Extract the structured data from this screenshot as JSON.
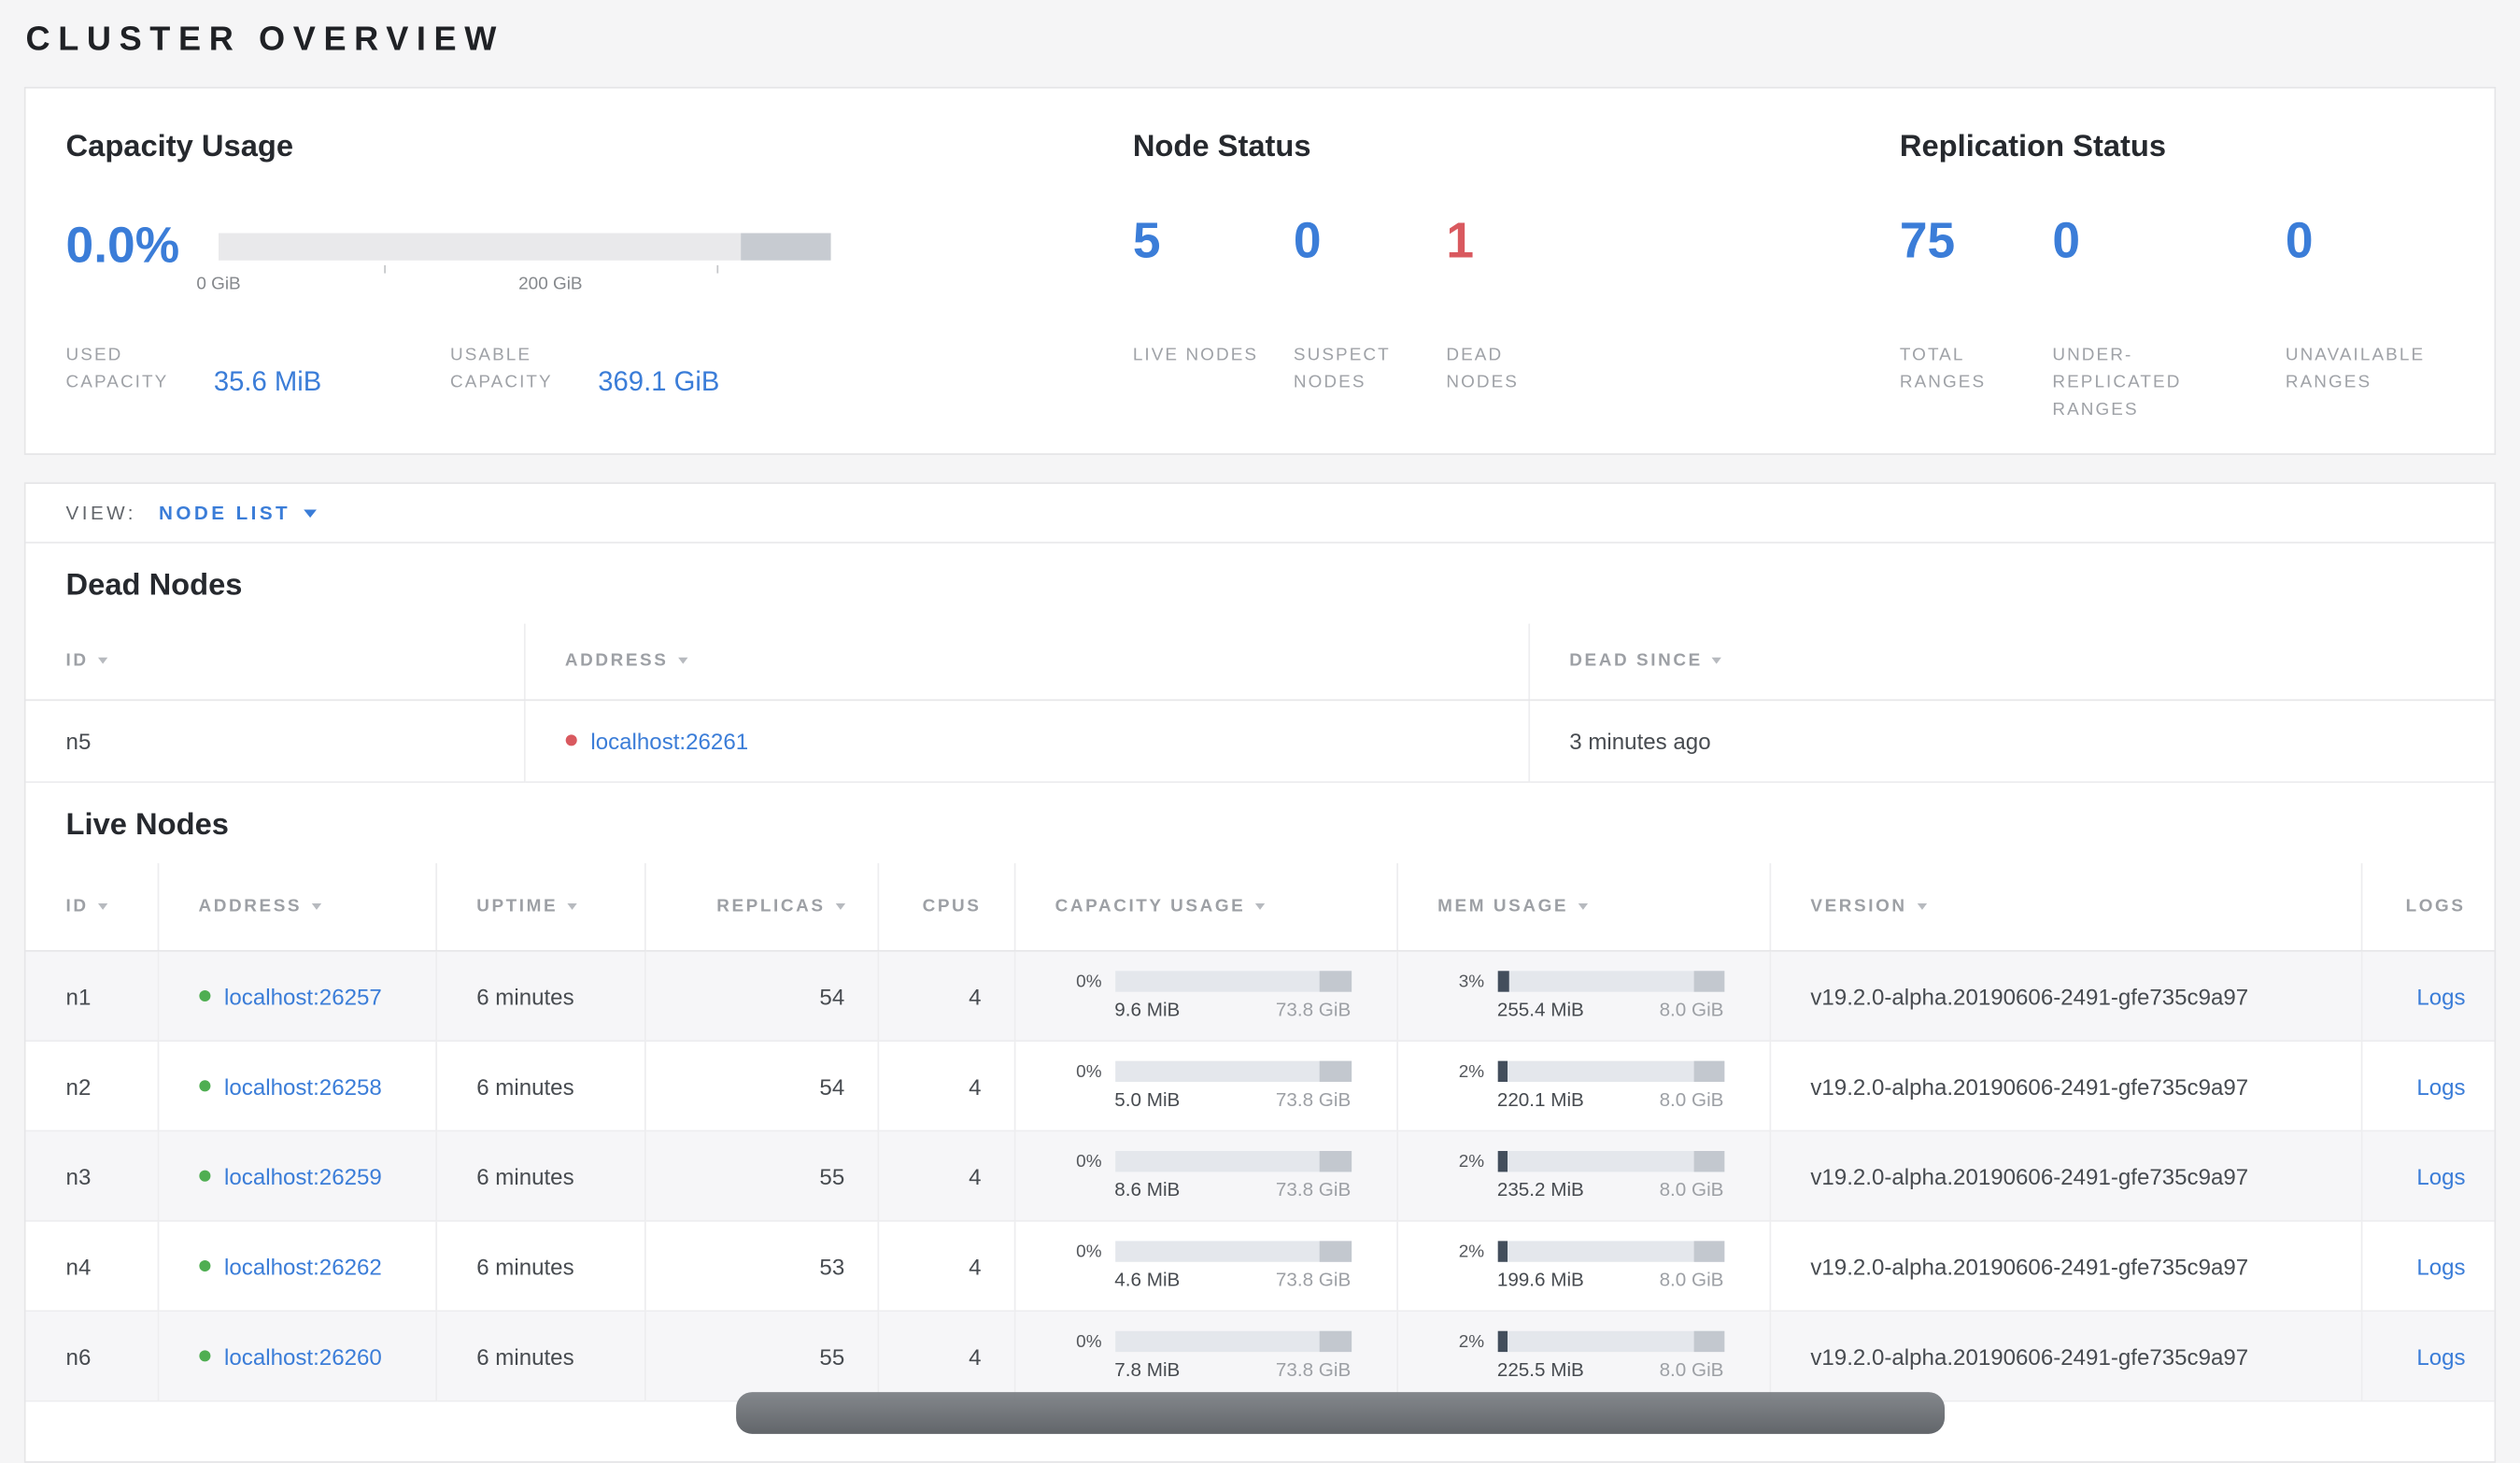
{
  "page": {
    "title": "CLUSTER OVERVIEW"
  },
  "colors": {
    "accent_blue": "#3b7dd8",
    "danger_red": "#d9595f",
    "healthy_green": "#4fae52"
  },
  "summary": {
    "capacity": {
      "title": "Capacity Usage",
      "percent": "0.0%",
      "bar": {
        "dark_from": 0.853
      },
      "axis": {
        "ticks": [
          {
            "pos": 0.0,
            "label": "0 GiB"
          },
          {
            "pos": 0.271,
            "label": ""
          },
          {
            "pos": 0.542,
            "label": "200 GiB"
          },
          {
            "pos": 0.813,
            "label": ""
          }
        ]
      },
      "used_label": "USED CAPACITY",
      "used_value": "35.6 MiB",
      "usable_label": "USABLE CAPACITY",
      "usable_value": "369.1 GiB"
    },
    "node_status": {
      "title": "Node Status",
      "stats": [
        {
          "value": "5",
          "label": "LIVE NODES",
          "color": "blue"
        },
        {
          "value": "0",
          "label": "SUSPECT NODES",
          "color": "blue"
        },
        {
          "value": "1",
          "label": "DEAD NODES",
          "color": "red"
        }
      ]
    },
    "replication": {
      "title": "Replication Status",
      "stats": [
        {
          "value": "75",
          "label": "TOTAL RANGES",
          "color": "blue"
        },
        {
          "value": "0",
          "label": "UNDER-REPLICATED RANGES",
          "color": "blue"
        },
        {
          "value": "0",
          "label": "UNAVAILABLE RANGES",
          "color": "blue"
        }
      ]
    }
  },
  "view_bar": {
    "label": "VIEW:",
    "selected": "NODE LIST"
  },
  "dead_nodes": {
    "title": "Dead Nodes",
    "headers": [
      {
        "label": "ID",
        "sortable": true
      },
      {
        "label": "ADDRESS",
        "sortable": true
      },
      {
        "label": "DEAD SINCE",
        "sortable": true
      }
    ],
    "rows": [
      {
        "id": "n5",
        "address": "localhost:26261",
        "dead_since": "3 minutes ago"
      }
    ]
  },
  "live_nodes": {
    "title": "Live Nodes",
    "bar_tail": 0.13,
    "headers": [
      {
        "label": "ID",
        "sortable": true
      },
      {
        "label": "ADDRESS",
        "sortable": true
      },
      {
        "label": "UPTIME",
        "sortable": true
      },
      {
        "label": "REPLICAS",
        "sortable": true
      },
      {
        "label": "CPUS",
        "sortable": false
      },
      {
        "label": "CAPACITY USAGE",
        "sortable": true
      },
      {
        "label": "MEM USAGE",
        "sortable": true
      },
      {
        "label": "VERSION",
        "sortable": true
      },
      {
        "label": "LOGS",
        "sortable": false
      }
    ],
    "rows": [
      {
        "id": "n1",
        "address": "localhost:26257",
        "uptime": "6 minutes",
        "replicas": "54",
        "cpus": "4",
        "capacity": {
          "pct": "0%",
          "used": "9.6 MiB",
          "total": "73.8 GiB"
        },
        "memory": {
          "pct": "3%",
          "used": "255.4 MiB",
          "total": "8.0 GiB"
        },
        "version": "v19.2.0-alpha.20190606-2491-gfe735c9a97",
        "logs": "Logs"
      },
      {
        "id": "n2",
        "address": "localhost:26258",
        "uptime": "6 minutes",
        "replicas": "54",
        "cpus": "4",
        "capacity": {
          "pct": "0%",
          "used": "5.0 MiB",
          "total": "73.8 GiB"
        },
        "memory": {
          "pct": "2%",
          "used": "220.1 MiB",
          "total": "8.0 GiB"
        },
        "version": "v19.2.0-alpha.20190606-2491-gfe735c9a97",
        "logs": "Logs"
      },
      {
        "id": "n3",
        "address": "localhost:26259",
        "uptime": "6 minutes",
        "replicas": "55",
        "cpus": "4",
        "capacity": {
          "pct": "0%",
          "used": "8.6 MiB",
          "total": "73.8 GiB"
        },
        "memory": {
          "pct": "2%",
          "used": "235.2 MiB",
          "total": "8.0 GiB"
        },
        "version": "v19.2.0-alpha.20190606-2491-gfe735c9a97",
        "logs": "Logs"
      },
      {
        "id": "n4",
        "address": "localhost:26262",
        "uptime": "6 minutes",
        "replicas": "53",
        "cpus": "4",
        "capacity": {
          "pct": "0%",
          "used": "4.6 MiB",
          "total": "73.8 GiB"
        },
        "memory": {
          "pct": "2%",
          "used": "199.6 MiB",
          "total": "8.0 GiB"
        },
        "version": "v19.2.0-alpha.20190606-2491-gfe735c9a97",
        "logs": "Logs"
      },
      {
        "id": "n6",
        "address": "localhost:26260",
        "uptime": "6 minutes",
        "replicas": "55",
        "cpus": "4",
        "capacity": {
          "pct": "0%",
          "used": "7.8 MiB",
          "total": "73.8 GiB"
        },
        "memory": {
          "pct": "2%",
          "used": "225.5 MiB",
          "total": "8.0 GiB"
        },
        "version": "v19.2.0-alpha.20190606-2491-gfe735c9a97",
        "logs": "Logs"
      }
    ]
  }
}
